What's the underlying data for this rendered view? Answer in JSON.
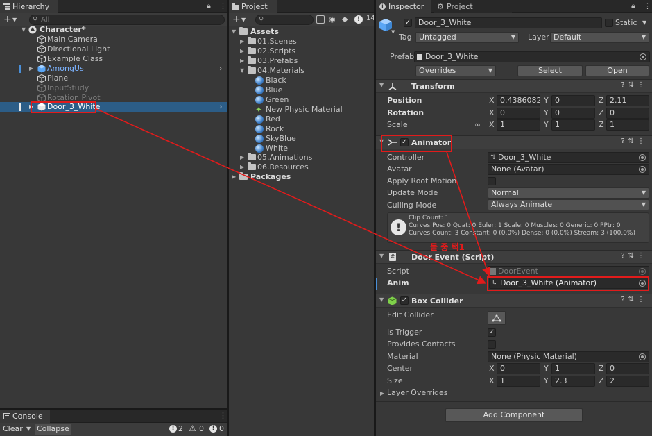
{
  "hierarchy": {
    "tab": "Hierarchy",
    "search_placeholder": "All",
    "scene": "Character*",
    "items": [
      {
        "label": "Main Camera"
      },
      {
        "label": "Directional Light"
      },
      {
        "label": "Example Class"
      },
      {
        "label": "AmongUs"
      },
      {
        "label": "Plane"
      },
      {
        "label": "InputStudy"
      },
      {
        "label": "Rotation Pivot"
      },
      {
        "label": "Door_3_White"
      }
    ]
  },
  "project": {
    "tab": "Project",
    "badge_count": "14",
    "root": "Assets",
    "folders": [
      "01.Scenes",
      "02.Scripts",
      "03.Prefabs",
      "04.Materials"
    ],
    "materials": [
      "Black",
      "Blue",
      "Green",
      "New Physic Material",
      "Red",
      "Rock",
      "SkyBlue",
      "White"
    ],
    "folders_after": [
      "05.Animations",
      "06.Resources"
    ],
    "packages": "Packages"
  },
  "inspector": {
    "tab_inspector": "Inspector",
    "tab_settings": "Project Settings",
    "object_name": "Door_3_White",
    "static_label": "Static",
    "tag_label": "Tag",
    "tag_value": "Untagged",
    "layer_label": "Layer",
    "layer_value": "Default",
    "prefab_label": "Prefab",
    "prefab_value": "Door_3_White",
    "overrides": "Overrides",
    "select": "Select",
    "open": "Open",
    "transform": {
      "title": "Transform",
      "position_label": "Position",
      "rotation_label": "Rotation",
      "scale_label": "Scale",
      "position": [
        "0.4386082",
        "0",
        "2.11"
      ],
      "rotation": [
        "0",
        "0",
        "0"
      ],
      "scale": [
        "1",
        "1",
        "1"
      ]
    },
    "animator": {
      "title": "Animator",
      "controller_label": "Controller",
      "controller_value": "Door_3_White",
      "avatar_label": "Avatar",
      "avatar_value": "None (Avatar)",
      "root_motion_label": "Apply Root Motion",
      "update_label": "Update Mode",
      "update_value": "Normal",
      "culling_label": "Culling Mode",
      "culling_value": "Always Animate",
      "info_line1": "Clip Count: 1",
      "info_line2": "Curves Pos: 0 Quat: 0 Euler: 1 Scale: 0 Muscles: 0 Generic: 0 PPtr: 0",
      "info_line3": "Curves Count: 3 Constant: 0 (0.0%) Dense: 0 (0.0%) Stream: 3 (100.0%)"
    },
    "door_event": {
      "title": "Door Event (Script)",
      "script_label": "Script",
      "script_value": "DoorEvent",
      "anim_label": "Anim",
      "anim_value": "Door_3_White (Animator)"
    },
    "box_collider": {
      "title": "Box Collider",
      "edit_label": "Edit Collider",
      "trigger_label": "Is Trigger",
      "contacts_label": "Provides Contacts",
      "material_label": "Material",
      "material_value": "None (Physic Material)",
      "center_label": "Center",
      "size_label": "Size",
      "center": [
        "0",
        "1",
        "0"
      ],
      "size": [
        "1",
        "2.3",
        "2"
      ],
      "layer_overrides": "Layer Overrides"
    },
    "add_component": "Add Component"
  },
  "console": {
    "tab": "Console",
    "clear": "Clear",
    "collapse": "Collapse",
    "info_count": "2",
    "warn_count": "0",
    "error_count": "0"
  },
  "annotation": {
    "text": "둘 중 택1",
    "color": "#e11b1b"
  },
  "axis_labels": {
    "x": "X",
    "y": "Y",
    "z": "Z"
  }
}
